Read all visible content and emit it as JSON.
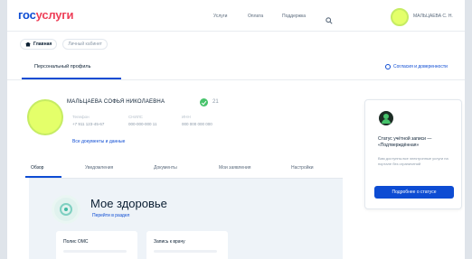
{
  "header": {
    "logo_part1": "гос",
    "logo_part2": "услуги",
    "nav": [
      "Услуги",
      "Оплата",
      "Поддержка"
    ],
    "user_name": "МАЛЬЦАЕВА С. Н."
  },
  "breadcrumb": {
    "home": "Главная",
    "current": "Личный кабинет"
  },
  "profile_tab": {
    "label": "Персональный профиль",
    "data_link": "Согласия и доверенности"
  },
  "profile": {
    "full_name": "МАЛЬЦАЕВА СОФЬЯ НИКОЛАЕВНА",
    "badge_count": "21",
    "fields": [
      {
        "label": "Телефон",
        "value": "+7 911 123-45-67"
      },
      {
        "label": "СНИЛС",
        "value": "000-000-000 11"
      },
      {
        "label": "ИНН",
        "value": "000 000 000 000"
      }
    ],
    "docs_link": "Все документы и данные"
  },
  "status_card": {
    "title": "Статус учётной записи — «Подтверждённая»",
    "description": "Вам доступны все электронные услуги на портале без ограничений",
    "button": "Подробнее о статусе"
  },
  "tabs": {
    "items": [
      "Обзор",
      "Уведомления",
      "Документы",
      "Мои заявления",
      "Настройки"
    ],
    "active_index": 0
  },
  "health": {
    "title": "Мое здоровье",
    "link": "Перейти в раздел",
    "cards": [
      {
        "title": "Полис ОМС"
      },
      {
        "title": "Запись к врачу"
      }
    ]
  }
}
